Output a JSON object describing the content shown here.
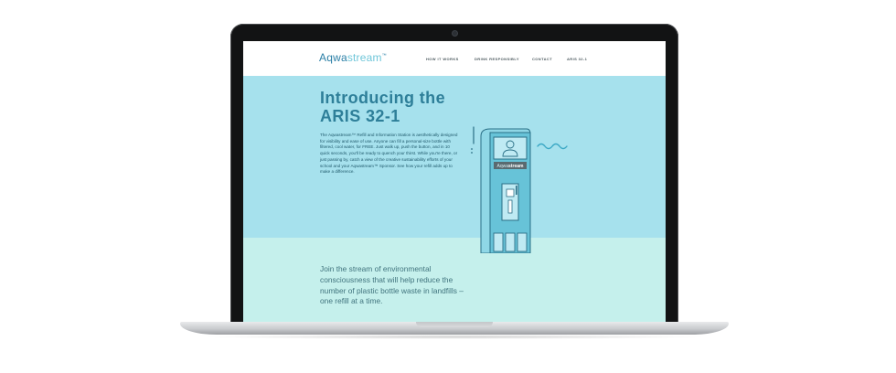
{
  "site": {
    "logo": {
      "part1": "Aqwa",
      "part2": "stream",
      "mark": "™"
    },
    "nav": [
      "HOW IT WORKS",
      "DRINK RESPONSIBLY",
      "CONTACT",
      "ARIS 32-1"
    ]
  },
  "hero": {
    "title_line1": "Introducing the",
    "title_line2": "ARIS 32-1",
    "body": "The Aqwastream™ Refill and Information Station is aesthetically designed for visibility and ease of use. Anyone can fill a personal-size bottle with filtered, cool water, for FREE. Just walk up, push the button, and in 10 quick seconds, you'll be ready to quench your thirst. While you're there, or just passing by, catch a view of the creative sustainability efforts of your school and your Aqwastream™ Sponsor. See how your refill adds up to make a difference."
  },
  "kiosk": {
    "brand_part1": "Aqwa",
    "brand_part2": "stream"
  },
  "cta": {
    "text": "Join the stream of environmental consciousness that will help reduce the number of plastic bottle waste in landfills – one refill at a time."
  },
  "colors": {
    "hero_bg": "#a6e1ed",
    "cta_bg": "#c5f0ec",
    "brand_dark": "#2b7fa6",
    "brand_light": "#6fc6d9",
    "kiosk_blue": "#67c3d8",
    "kiosk_stroke": "#2a6f86"
  },
  "icons": [
    "webcam-icon",
    "person-icon",
    "wave-icon",
    "water-drop-icon"
  ]
}
